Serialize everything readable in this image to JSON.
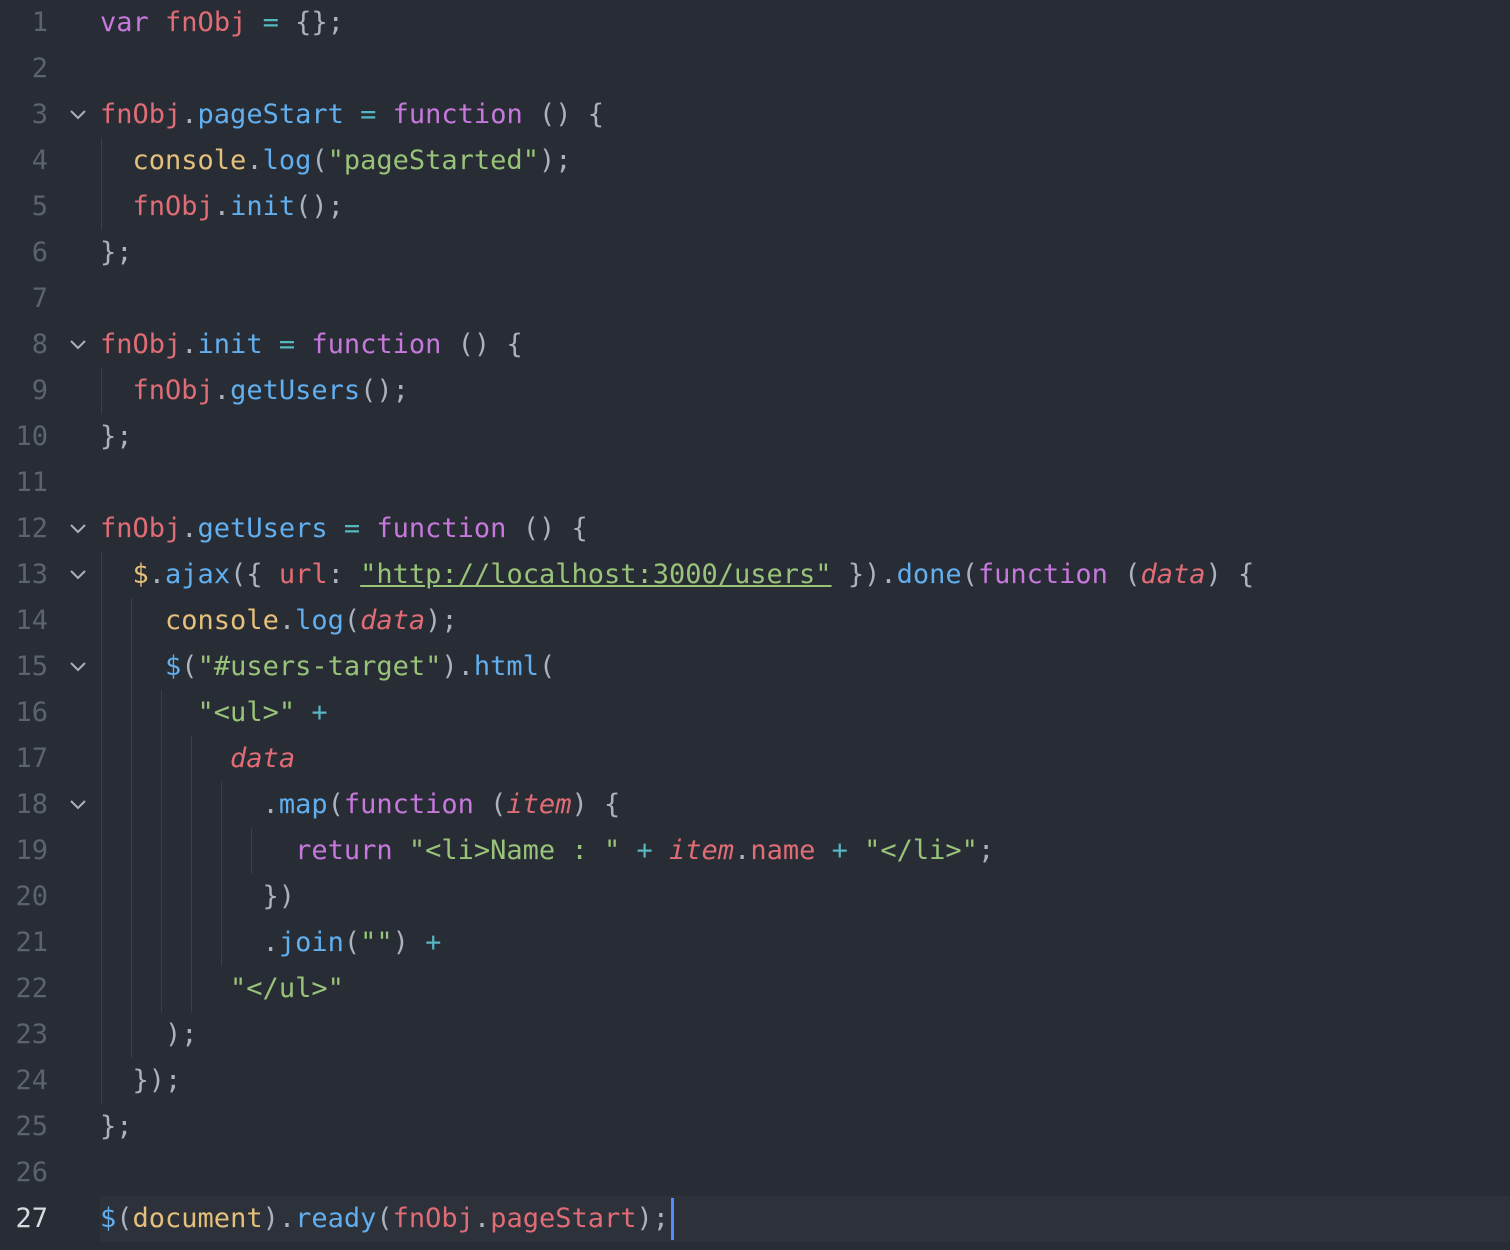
{
  "editor": {
    "active_line": 27,
    "lines": [
      {
        "n": "1",
        "fold": false,
        "tokens": [
          [
            "kw",
            "var"
          ],
          [
            "pun",
            " "
          ],
          [
            "var",
            "fnObj"
          ],
          [
            "pun",
            " "
          ],
          [
            "op",
            "="
          ],
          [
            "pun",
            " {};"
          ]
        ]
      },
      {
        "n": "2",
        "fold": false,
        "tokens": []
      },
      {
        "n": "3",
        "fold": true,
        "tokens": [
          [
            "var",
            "fnObj"
          ],
          [
            "pun",
            "."
          ],
          [
            "prop",
            "pageStart"
          ],
          [
            "pun",
            " "
          ],
          [
            "op",
            "="
          ],
          [
            "pun",
            " "
          ],
          [
            "kw",
            "function"
          ],
          [
            "pun",
            " () {"
          ]
        ]
      },
      {
        "n": "4",
        "fold": false,
        "tokens": [
          [
            "pun",
            "  "
          ],
          [
            "cls",
            "console"
          ],
          [
            "pun",
            "."
          ],
          [
            "fn",
            "log"
          ],
          [
            "pun",
            "("
          ],
          [
            "str",
            "\"pageStarted\""
          ],
          [
            "pun",
            ");"
          ]
        ]
      },
      {
        "n": "5",
        "fold": false,
        "tokens": [
          [
            "pun",
            "  "
          ],
          [
            "var",
            "fnObj"
          ],
          [
            "pun",
            "."
          ],
          [
            "fn",
            "init"
          ],
          [
            "pun",
            "();"
          ]
        ]
      },
      {
        "n": "6",
        "fold": false,
        "tokens": [
          [
            "pun",
            "};"
          ]
        ]
      },
      {
        "n": "7",
        "fold": false,
        "tokens": []
      },
      {
        "n": "8",
        "fold": true,
        "tokens": [
          [
            "var",
            "fnObj"
          ],
          [
            "pun",
            "."
          ],
          [
            "prop",
            "init"
          ],
          [
            "pun",
            " "
          ],
          [
            "op",
            "="
          ],
          [
            "pun",
            " "
          ],
          [
            "kw",
            "function"
          ],
          [
            "pun",
            " () {"
          ]
        ]
      },
      {
        "n": "9",
        "fold": false,
        "tokens": [
          [
            "pun",
            "  "
          ],
          [
            "var",
            "fnObj"
          ],
          [
            "pun",
            "."
          ],
          [
            "fn",
            "getUsers"
          ],
          [
            "pun",
            "();"
          ]
        ]
      },
      {
        "n": "10",
        "fold": false,
        "tokens": [
          [
            "pun",
            "};"
          ]
        ]
      },
      {
        "n": "11",
        "fold": false,
        "tokens": []
      },
      {
        "n": "12",
        "fold": true,
        "tokens": [
          [
            "var",
            "fnObj"
          ],
          [
            "pun",
            "."
          ],
          [
            "prop",
            "getUsers"
          ],
          [
            "pun",
            " "
          ],
          [
            "op",
            "="
          ],
          [
            "pun",
            " "
          ],
          [
            "kw",
            "function"
          ],
          [
            "pun",
            " () {"
          ]
        ]
      },
      {
        "n": "13",
        "fold": true,
        "tokens": [
          [
            "pun",
            "  "
          ],
          [
            "cls",
            "$"
          ],
          [
            "pun",
            "."
          ],
          [
            "fn",
            "ajax"
          ],
          [
            "pun",
            "({ "
          ],
          [
            "var",
            "url"
          ],
          [
            "pun",
            ": "
          ],
          [
            "url",
            "\"http://localhost:3000/users\""
          ],
          [
            "pun",
            " })."
          ],
          [
            "fn",
            "done"
          ],
          [
            "pun",
            "("
          ],
          [
            "kw",
            "function"
          ],
          [
            "pun",
            " ("
          ],
          [
            "param",
            "data"
          ],
          [
            "pun",
            ") {"
          ]
        ]
      },
      {
        "n": "14",
        "fold": false,
        "tokens": [
          [
            "pun",
            "    "
          ],
          [
            "cls",
            "console"
          ],
          [
            "pun",
            "."
          ],
          [
            "fn",
            "log"
          ],
          [
            "pun",
            "("
          ],
          [
            "param",
            "data"
          ],
          [
            "pun",
            ");"
          ]
        ]
      },
      {
        "n": "15",
        "fold": true,
        "tokens": [
          [
            "pun",
            "    "
          ],
          [
            "fn",
            "$"
          ],
          [
            "pun",
            "("
          ],
          [
            "str",
            "\"#users-target\""
          ],
          [
            "pun",
            ")."
          ],
          [
            "fn",
            "html"
          ],
          [
            "pun",
            "("
          ]
        ]
      },
      {
        "n": "16",
        "fold": false,
        "tokens": [
          [
            "pun",
            "      "
          ],
          [
            "str",
            "\"<ul>\""
          ],
          [
            "pun",
            " "
          ],
          [
            "op",
            "+"
          ]
        ]
      },
      {
        "n": "17",
        "fold": false,
        "tokens": [
          [
            "pun",
            "        "
          ],
          [
            "param",
            "data"
          ]
        ]
      },
      {
        "n": "18",
        "fold": true,
        "tokens": [
          [
            "pun",
            "          ."
          ],
          [
            "fn",
            "map"
          ],
          [
            "pun",
            "("
          ],
          [
            "kw",
            "function"
          ],
          [
            "pun",
            " ("
          ],
          [
            "param",
            "item"
          ],
          [
            "pun",
            ") {"
          ]
        ]
      },
      {
        "n": "19",
        "fold": false,
        "tokens": [
          [
            "pun",
            "            "
          ],
          [
            "kw",
            "return"
          ],
          [
            "pun",
            " "
          ],
          [
            "str",
            "\"<li>Name : \""
          ],
          [
            "pun",
            " "
          ],
          [
            "op",
            "+"
          ],
          [
            "pun",
            " "
          ],
          [
            "param",
            "item"
          ],
          [
            "pun",
            "."
          ],
          [
            "var",
            "name"
          ],
          [
            "pun",
            " "
          ],
          [
            "op",
            "+"
          ],
          [
            "pun",
            " "
          ],
          [
            "str",
            "\"</li>\""
          ],
          [
            "pun",
            ";"
          ]
        ]
      },
      {
        "n": "20",
        "fold": false,
        "tokens": [
          [
            "pun",
            "          })"
          ]
        ]
      },
      {
        "n": "21",
        "fold": false,
        "tokens": [
          [
            "pun",
            "          ."
          ],
          [
            "fn",
            "join"
          ],
          [
            "pun",
            "("
          ],
          [
            "str",
            "\"\""
          ],
          [
            "pun",
            ") "
          ],
          [
            "op",
            "+"
          ]
        ]
      },
      {
        "n": "22",
        "fold": false,
        "tokens": [
          [
            "pun",
            "        "
          ],
          [
            "str",
            "\"</ul>\""
          ]
        ]
      },
      {
        "n": "23",
        "fold": false,
        "tokens": [
          [
            "pun",
            "    );"
          ]
        ]
      },
      {
        "n": "24",
        "fold": false,
        "tokens": [
          [
            "pun",
            "  });"
          ]
        ]
      },
      {
        "n": "25",
        "fold": false,
        "tokens": [
          [
            "pun",
            "};"
          ]
        ]
      },
      {
        "n": "26",
        "fold": false,
        "tokens": []
      },
      {
        "n": "27",
        "fold": false,
        "tokens": [
          [
            "fn",
            "$"
          ],
          [
            "pun",
            "("
          ],
          [
            "cls",
            "document"
          ],
          [
            "pun",
            ")."
          ],
          [
            "fn",
            "ready"
          ],
          [
            "pun",
            "("
          ],
          [
            "var",
            "fnObj"
          ],
          [
            "pun",
            "."
          ],
          [
            "var",
            "pageStart"
          ],
          [
            "pun",
            ");"
          ]
        ]
      }
    ]
  }
}
